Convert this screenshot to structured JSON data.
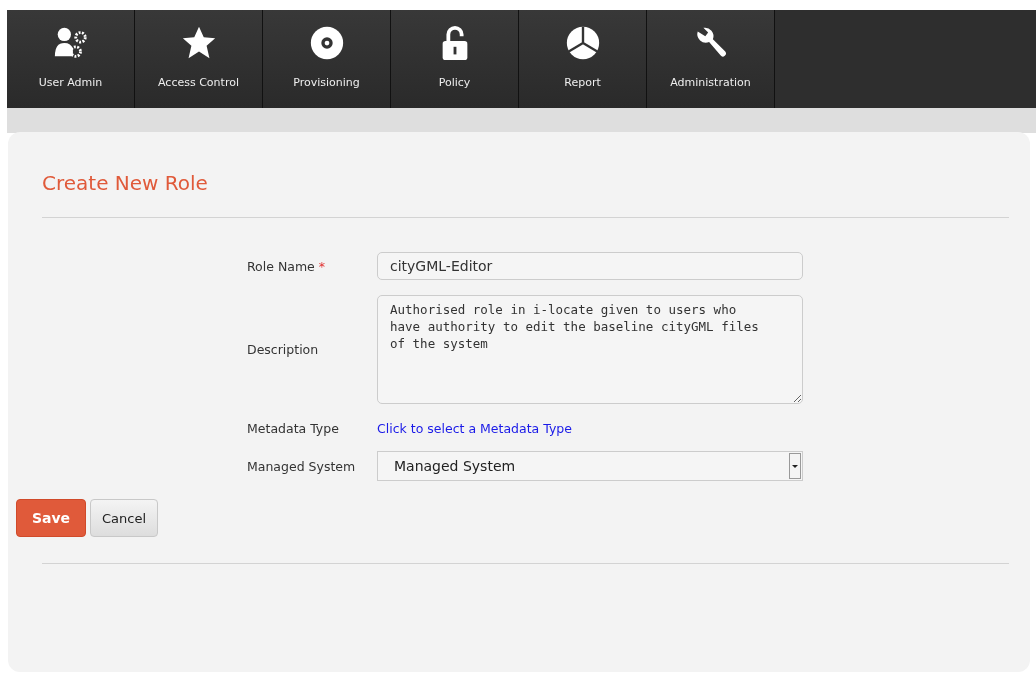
{
  "nav": [
    {
      "label": "User Admin",
      "kind": "users"
    },
    {
      "label": "Access Control",
      "kind": "star"
    },
    {
      "label": "Provisioning",
      "kind": "disc"
    },
    {
      "label": "Policy",
      "kind": "lock"
    },
    {
      "label": "Report",
      "kind": "pie"
    },
    {
      "label": "Administration",
      "kind": "wrench"
    }
  ],
  "title": "Create New Role",
  "fields": [
    {
      "kind": "text",
      "label": "Role Name",
      "required_mark": "*",
      "value": "cityGML-Editor"
    },
    {
      "kind": "textarea",
      "label": "Description",
      "value": "Authorised role in i-locate given to users who have authority to edit the baseline cityGML files of the system"
    },
    {
      "kind": "link",
      "label": "Metadata Type",
      "value": "Click to select a Metadata Type"
    },
    {
      "kind": "select",
      "label": "Managed System",
      "value": "Managed System"
    }
  ],
  "buttons": [
    {
      "label": "Save",
      "kind": "primary"
    },
    {
      "label": "Cancel",
      "kind": "secondary"
    }
  ]
}
